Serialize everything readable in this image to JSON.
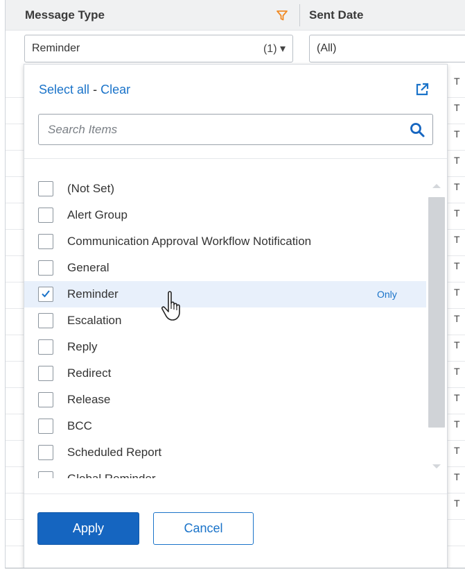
{
  "header": {
    "message_type_label": "Message Type",
    "sent_date_label": "Sent Date"
  },
  "filter_row": {
    "message_type_value": "Reminder",
    "message_type_count": "(1) ▾",
    "sent_date_value": "(All)"
  },
  "background_rows": {
    "truncated_text": "T"
  },
  "popup": {
    "select_all_label": "Select all",
    "separator": "-",
    "clear_label": "Clear",
    "search_placeholder": "Search Items",
    "only_label": "Only",
    "items": [
      {
        "label": "(Not Set)",
        "checked": false
      },
      {
        "label": "Alert Group",
        "checked": false
      },
      {
        "label": "Communication Approval Workflow Notification",
        "checked": false
      },
      {
        "label": "General",
        "checked": false
      },
      {
        "label": "Reminder",
        "checked": true
      },
      {
        "label": "Escalation",
        "checked": false
      },
      {
        "label": "Reply",
        "checked": false
      },
      {
        "label": "Redirect",
        "checked": false
      },
      {
        "label": "Release",
        "checked": false
      },
      {
        "label": "BCC",
        "checked": false
      },
      {
        "label": "Scheduled Report",
        "checked": false
      },
      {
        "label": "Global Reminder",
        "checked": false
      }
    ],
    "apply_label": "Apply",
    "cancel_label": "Cancel"
  },
  "colors": {
    "accent": "#1a73c9",
    "primary_button": "#1565c0",
    "filter_icon": "#f08a24",
    "selected_row": "#e8f0fb"
  },
  "icons": {
    "filter": "funnel-icon",
    "open_external": "external-link-icon",
    "search": "search-icon",
    "check": "check-icon",
    "cursor": "hand-pointer-icon"
  }
}
